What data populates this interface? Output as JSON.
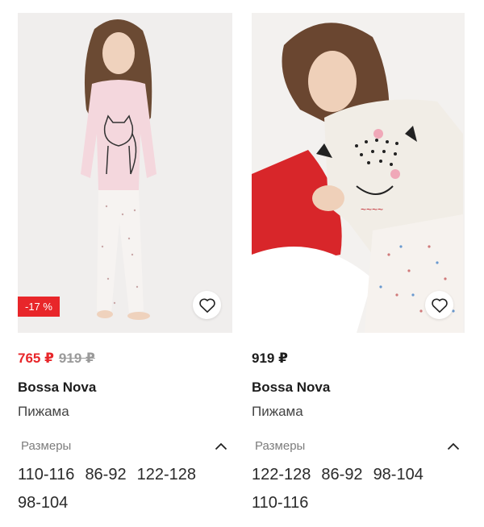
{
  "products": [
    {
      "discount_badge": "-17 %",
      "price": "765 ₽",
      "old_price": "919 ₽",
      "brand": "Bossa Nova",
      "type": "Пижама",
      "sizes_label": "Размеры",
      "sizes": [
        "110-116",
        "86-92",
        "122-128",
        "98-104"
      ]
    },
    {
      "price": "919 ₽",
      "brand": "Bossa Nova",
      "type": "Пижама",
      "sizes_label": "Размеры",
      "sizes": [
        "122-128",
        "86-92",
        "98-104",
        "110-116"
      ]
    }
  ],
  "colors": {
    "sale": "#e8262a",
    "text": "#1c1c1c",
    "muted": "#7c7c7c"
  },
  "icons": {
    "favorite": "heart-outline-icon",
    "collapse": "chevron-up-icon"
  }
}
